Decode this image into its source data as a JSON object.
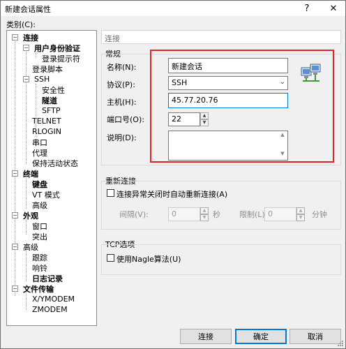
{
  "window": {
    "title": "新建会话属性",
    "help_label": "?",
    "close_label": "✕"
  },
  "sidebar": {
    "category_label": "类别(C):",
    "items": [
      {
        "label": "连接",
        "bold": true
      },
      {
        "label": "用户身份验证",
        "bold": true
      },
      {
        "label": "登录提示符",
        "bold": false
      },
      {
        "label": "登录脚本",
        "bold": false
      },
      {
        "label": "SSH",
        "bold": false
      },
      {
        "label": "安全性",
        "bold": false
      },
      {
        "label": "隧道",
        "bold": true
      },
      {
        "label": "SFTP",
        "bold": false
      },
      {
        "label": "TELNET",
        "bold": false
      },
      {
        "label": "RLOGIN",
        "bold": false
      },
      {
        "label": "串口",
        "bold": false
      },
      {
        "label": "代理",
        "bold": false
      },
      {
        "label": "保持活动状态",
        "bold": false
      },
      {
        "label": "终端",
        "bold": true
      },
      {
        "label": "键盘",
        "bold": true
      },
      {
        "label": "VT 模式",
        "bold": false
      },
      {
        "label": "高级",
        "bold": false
      },
      {
        "label": "外观",
        "bold": true
      },
      {
        "label": "窗口",
        "bold": false
      },
      {
        "label": "突出",
        "bold": false
      },
      {
        "label": "高级",
        "bold": false
      },
      {
        "label": "跟踪",
        "bold": false
      },
      {
        "label": "响铃",
        "bold": false
      },
      {
        "label": "日志记录",
        "bold": true
      },
      {
        "label": "文件传输",
        "bold": true
      },
      {
        "label": "X/YMODEM",
        "bold": false
      },
      {
        "label": "ZMODEM",
        "bold": false
      }
    ]
  },
  "main": {
    "breadcrumb": "连接",
    "general": {
      "title": "常规",
      "name_label": "名称(N):",
      "name_value": "新建会话",
      "protocol_label": "协议(P):",
      "protocol_value": "SSH",
      "host_label": "主机(H):",
      "host_value": "45.77.20.76",
      "port_label": "端口号(O):",
      "port_value": "22",
      "desc_label": "说明(D):",
      "desc_value": ""
    },
    "reconnect": {
      "title": "重新连接",
      "checkbox_label": "连接异常关闭时自动重新连接(A)",
      "interval_label": "间隔(V):",
      "interval_value": "0",
      "interval_unit": "秒",
      "limit_label": "限制(L):",
      "limit_value": "0",
      "limit_unit": "分钟"
    },
    "tcp": {
      "title": "TCP选项",
      "checkbox_label": "使用Nagle算法(U)"
    }
  },
  "footer": {
    "connect_label": "连接",
    "ok_label": "确定",
    "cancel_label": "取消"
  },
  "colors": {
    "highlight": "#e0232b",
    "focus": "#0078d7"
  }
}
